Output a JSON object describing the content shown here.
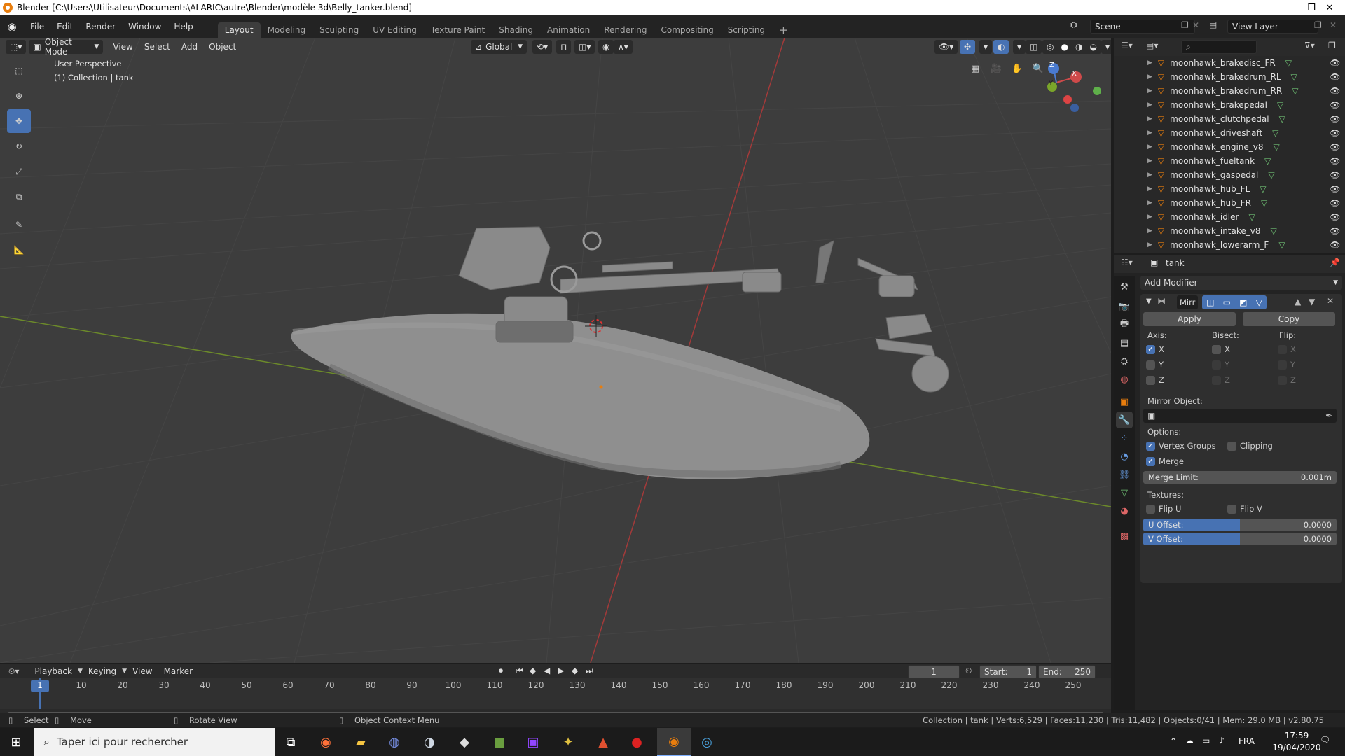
{
  "window": {
    "title": "Blender [C:\\Users\\Utilisateur\\Documents\\ALARIC\\autre\\Blender\\modèle 3d\\Belly_tanker.blend]",
    "controls": [
      "—",
      "❐",
      "✕"
    ]
  },
  "menubar": {
    "menus": [
      "File",
      "Edit",
      "Render",
      "Window",
      "Help"
    ],
    "workspaces": [
      "Layout",
      "Modeling",
      "Sculpting",
      "UV Editing",
      "Texture Paint",
      "Shading",
      "Animation",
      "Rendering",
      "Compositing",
      "Scripting"
    ],
    "active_workspace": "Layout",
    "add_workspace": "+",
    "scene": "Scene",
    "view_layer": "View Layer"
  },
  "viewport": {
    "mode": "Object Mode",
    "menus": [
      "View",
      "Select",
      "Add",
      "Object"
    ],
    "orientation": "Global",
    "overlay_title": "User Perspective",
    "overlay_collection": "(1) Collection | tank",
    "gizmo_axes": [
      "X",
      "Y",
      "Z"
    ]
  },
  "outliner": {
    "search_placeholder": "",
    "items": [
      "moonhawk_brakedisc_FR",
      "moonhawk_brakedrum_RL",
      "moonhawk_brakedrum_RR",
      "moonhawk_brakepedal",
      "moonhawk_clutchpedal",
      "moonhawk_driveshaft",
      "moonhawk_engine_v8",
      "moonhawk_fueltank",
      "moonhawk_gaspedal",
      "moonhawk_hub_FL",
      "moonhawk_hub_FR",
      "moonhawk_idler",
      "moonhawk_intake_v8",
      "moonhawk_lowerarm_F"
    ]
  },
  "properties": {
    "object_name": "tank",
    "add_modifier": "Add Modifier",
    "modifier_name": "Mirr",
    "apply_label": "Apply",
    "copy_label": "Copy",
    "axis_label": "Axis:",
    "bisect_label": "Bisect:",
    "flip_label": "Flip:",
    "axis": {
      "x": true,
      "y": false,
      "z": false
    },
    "bisect": {
      "x": false,
      "y": false,
      "z": false
    },
    "flip": {
      "x": false,
      "y": false,
      "z": false
    },
    "axis_names": [
      "X",
      "Y",
      "Z"
    ],
    "mirror_object_label": "Mirror Object:",
    "options_label": "Options:",
    "vertex_groups_label": "Vertex Groups",
    "vertex_groups": true,
    "clipping_label": "Clipping",
    "clipping": false,
    "merge_label": "Merge",
    "merge": true,
    "merge_limit_label": "Merge Limit:",
    "merge_limit_value": "0.001m",
    "textures_label": "Textures:",
    "flip_u_label": "Flip U",
    "flip_v_label": "Flip V",
    "u_offset_label": "U Offset:",
    "u_offset_value": "0.0000",
    "v_offset_label": "V Offset:",
    "v_offset_value": "0.0000"
  },
  "timeline": {
    "menus": [
      "Playback",
      "Keying",
      "View",
      "Marker"
    ],
    "current_frame": "1",
    "start_label": "Start:",
    "start_value": "1",
    "end_label": "End:",
    "end_value": "250",
    "ticks": [
      "1",
      "10",
      "20",
      "30",
      "40",
      "50",
      "60",
      "70",
      "80",
      "90",
      "100",
      "110",
      "120",
      "130",
      "140",
      "150",
      "160",
      "170",
      "180",
      "190",
      "200",
      "210",
      "220",
      "230",
      "240",
      "250"
    ]
  },
  "statusbar": {
    "select": "Select",
    "move": "Move",
    "rotate": "Rotate View",
    "context": "Object Context Menu",
    "stats": "Collection | tank | Verts:6,529 | Faces:11,230 | Tris:11,482 | Objects:0/41 | Mem: 29.0 MB | v2.80.75"
  },
  "taskbar": {
    "search_placeholder": "Taper ici pour rechercher",
    "lang": "FRA",
    "time": "17:59",
    "date": "19/04/2020"
  },
  "colors": {
    "accent": "#4772b3",
    "viewport_bg": "#3d3d3d",
    "object_orange": "#e87d0d",
    "mesh_green": "#6fbf73"
  }
}
